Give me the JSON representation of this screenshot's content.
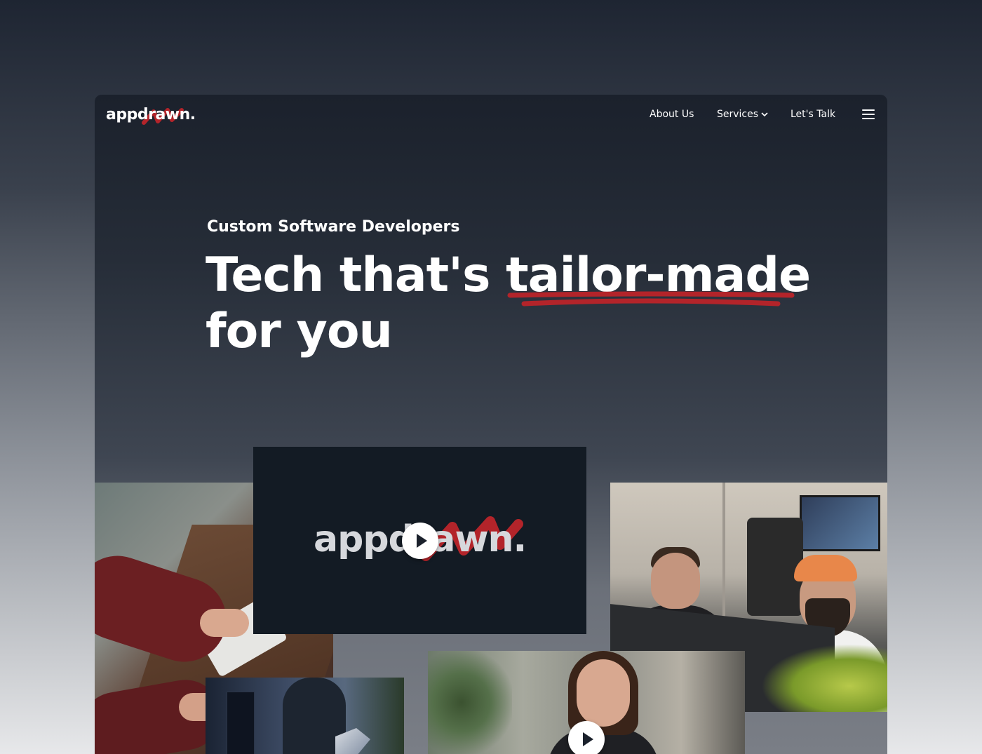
{
  "brand": {
    "logo_text": "appdrawn.",
    "accent_color": "#b3242a"
  },
  "nav": {
    "about": "About Us",
    "services": "Services",
    "talk": "Let's Talk"
  },
  "hero": {
    "eyebrow": "Custom Software Developers",
    "headline_part1": "Tech that's ",
    "headline_highlight": "tailor-made",
    "headline_part2": "for you"
  },
  "media": {
    "video_logo_text": "appdrawn."
  },
  "icons": {
    "services_chevron": "chevron-down-icon",
    "menu": "hamburger-menu-icon",
    "play": "play-icon"
  }
}
